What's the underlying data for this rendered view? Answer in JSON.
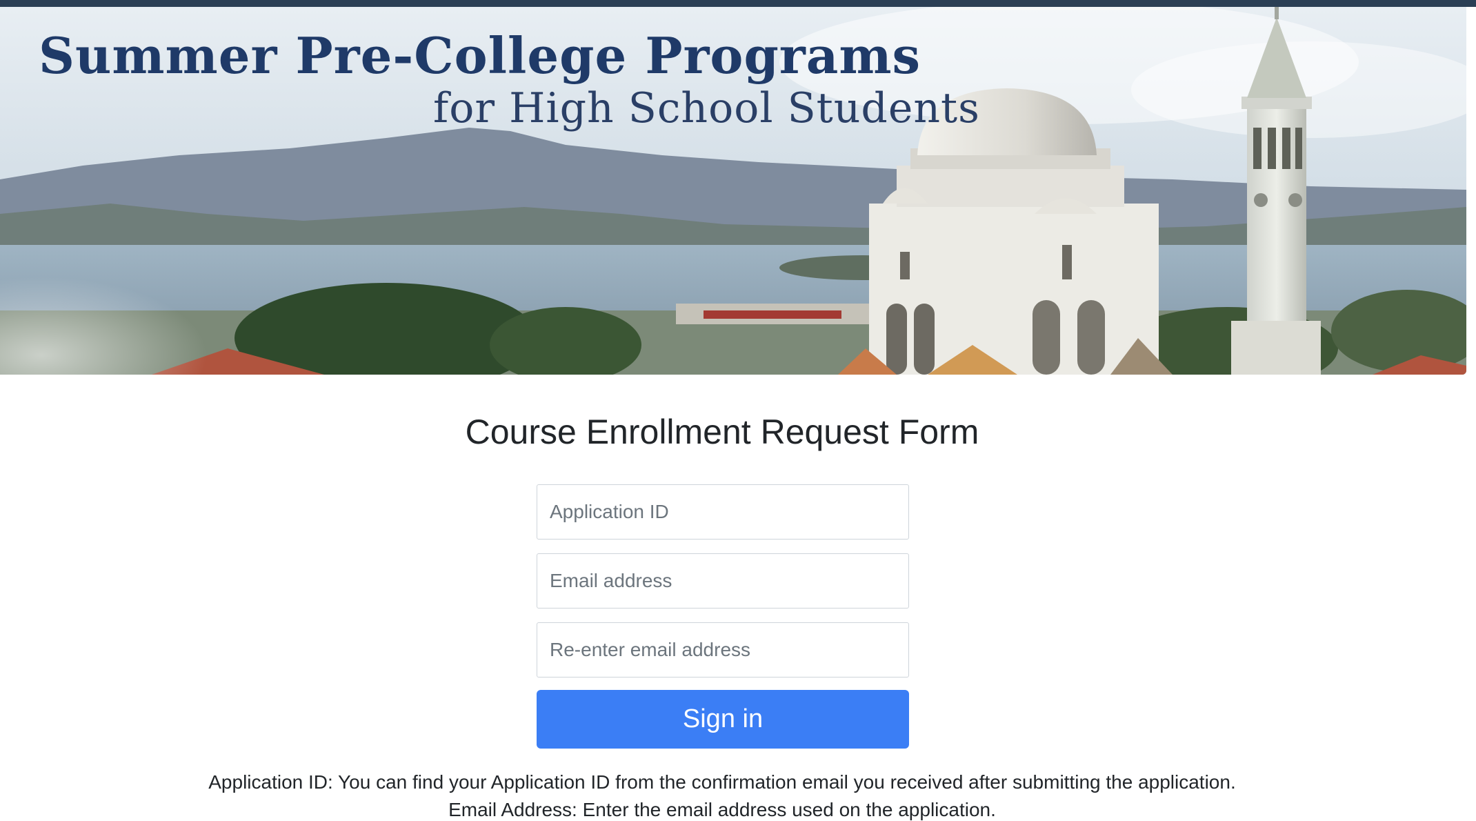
{
  "banner": {
    "title": "Summer Pre-College Programs",
    "subtitle": "for High School Students",
    "image": "campus-landscape-photo"
  },
  "form": {
    "title": "Course Enrollment Request Form",
    "application_id_placeholder": "Application ID",
    "email_placeholder": "Email address",
    "email_confirm_placeholder": "Re-enter email address",
    "submit_label": "Sign in"
  },
  "help": {
    "application_id_note": "Application ID: You can find your Application ID from the confirmation email you received after submitting the application.",
    "email_note": "Email Address: Enter the email address used on the application."
  },
  "colors": {
    "top_bar": "#2b3f55",
    "title_navy": "#1f3a68",
    "button_blue": "#3b7ef5"
  }
}
